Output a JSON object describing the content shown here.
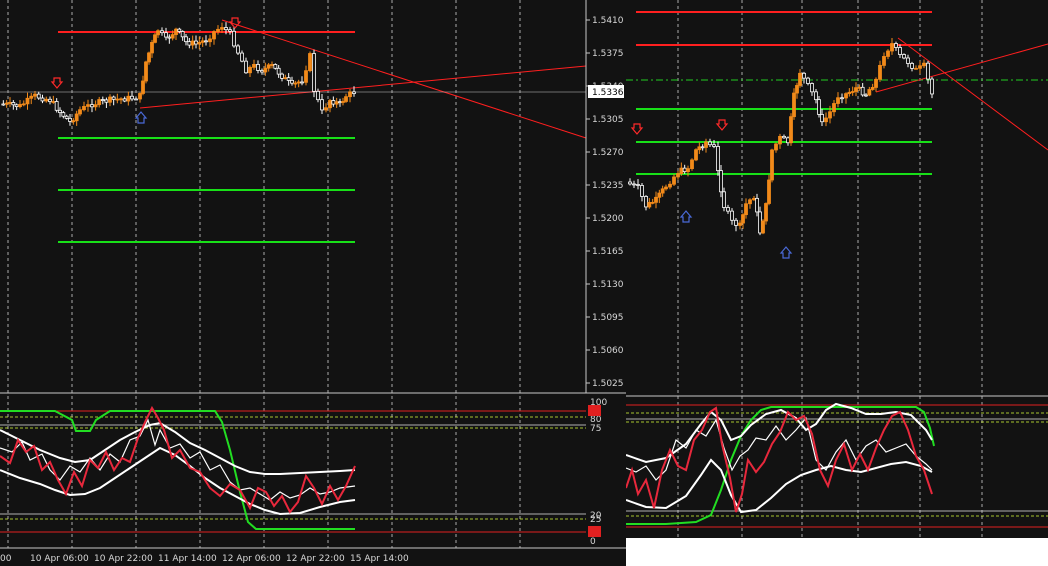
{
  "colors": {
    "background": "#121212",
    "axis": "#c8c8c8",
    "grid": "#d0d0d0",
    "bull_candle": "#f28a1a",
    "bear_candle": "#ffffff",
    "resistance": "#ff1f1f",
    "support": "#18e018",
    "sell_arrow": "#ff2a2a",
    "buy_arrow": "#4a6ad8",
    "osc_fast": "#e8283c",
    "osc_bands": "#ffffff",
    "osc_slow": "#22dd22",
    "osc_level": "#d8ff38"
  },
  "left_chart": {
    "price_axis": [
      "1.5410",
      "1.5375",
      "1.5340",
      "1.5305",
      "1.5270",
      "1.5235",
      "1.5200",
      "1.5165",
      "1.5130",
      "1.5095",
      "1.5060",
      "1.5025"
    ],
    "current_price": "1.5336",
    "time_axis": [
      "10 Apr 06:00",
      "10 Apr 22:00",
      "11 Apr 14:00",
      "12 Apr 06:00",
      "12 Apr 22:00",
      "15 Apr 14:00"
    ],
    "time_axis_cut": ":00",
    "osc_axis": [
      "100",
      "90",
      "80",
      "75",
      "20",
      "25",
      "10",
      "0"
    ],
    "sell_arrow_icon": "arrow-down-icon",
    "buy_arrow_icon": "arrow-up-icon"
  },
  "right_chart": {
    "sell_arrow_icon": "arrow-down-icon",
    "buy_arrow_icon": "arrow-up-icon"
  }
}
